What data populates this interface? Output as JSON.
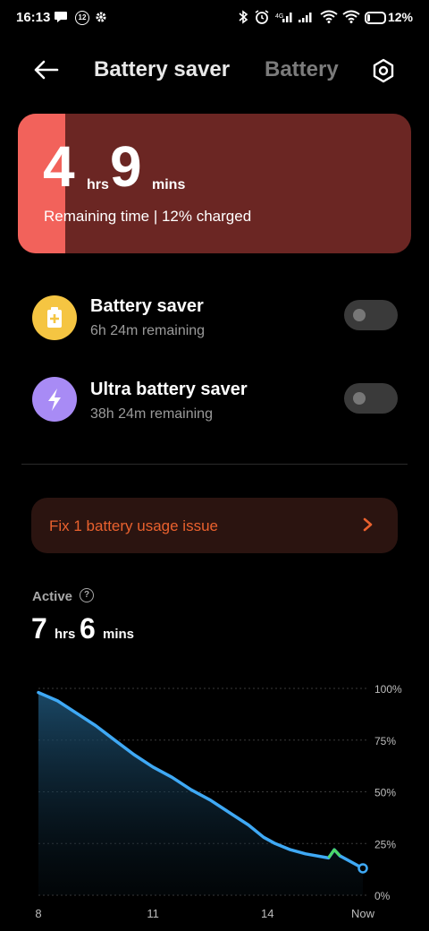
{
  "status_bar": {
    "time": "16:13",
    "notification_count": "12",
    "battery_percent": "12%",
    "icons": [
      "message-icon",
      "badge-12-icon",
      "gear-icon",
      "bluetooth-icon",
      "alarm-icon",
      "signal-icon",
      "signal-icon",
      "wifi-icon",
      "wifi-icon",
      "battery-icon"
    ]
  },
  "header": {
    "back_icon": "arrow-left-icon",
    "title": "Battery saver",
    "tab_inactive": "Battery",
    "settings_icon": "settings-icon"
  },
  "battery_card": {
    "hours": "4",
    "hours_unit": "hrs",
    "mins": "9",
    "mins_unit": "mins",
    "subtitle": "Remaining time | 12% charged",
    "charge_level": 0.12,
    "colors": {
      "fill": "#f2625b",
      "background": "#6b2623"
    }
  },
  "savers": [
    {
      "title": "Battery saver",
      "subtitle": "6h 24m remaining",
      "icon": "battery-plus-icon",
      "icon_color": "#f5c542",
      "enabled": false
    },
    {
      "title": "Ultra battery saver",
      "subtitle": "38h 24m remaining",
      "icon": "lightning-icon",
      "icon_color": "#a88bf5",
      "enabled": false
    }
  ],
  "issue_banner": {
    "text": "Fix 1 battery usage issue",
    "icon": "chevron-right-icon",
    "color": "#e9612e"
  },
  "active": {
    "label": "Active",
    "help_icon": "help-icon",
    "help_glyph": "?",
    "hours": "7",
    "hours_unit": "hrs",
    "mins": "6",
    "mins_unit": "mins"
  },
  "chart_data": {
    "type": "area",
    "title": "",
    "xlabel": "",
    "ylabel": "",
    "x_tick_labels": [
      "8",
      "11",
      "14",
      "Now"
    ],
    "y_tick_labels": [
      "100%",
      "75%",
      "50%",
      "25%",
      "0%"
    ],
    "ylim": [
      0,
      100
    ],
    "grid": true,
    "line_color": "#3fa9f5",
    "charging_color": "#4cd964",
    "series": [
      {
        "name": "",
        "x": [
          8.0,
          8.5,
          9.0,
          9.5,
          10.0,
          10.5,
          11.0,
          11.5,
          12.0,
          12.5,
          13.0,
          13.5,
          13.9,
          14.2,
          14.6,
          15.0,
          15.6,
          15.75,
          15.9,
          16.2,
          16.5
        ],
        "y": [
          98,
          94,
          88,
          82,
          75,
          68,
          62,
          57,
          51,
          46,
          40,
          34,
          28,
          25,
          22,
          20,
          18,
          22,
          19,
          16,
          13
        ]
      }
    ],
    "charging_segment_x": [
      15.6,
      15.9
    ],
    "now_x": 16.5
  }
}
